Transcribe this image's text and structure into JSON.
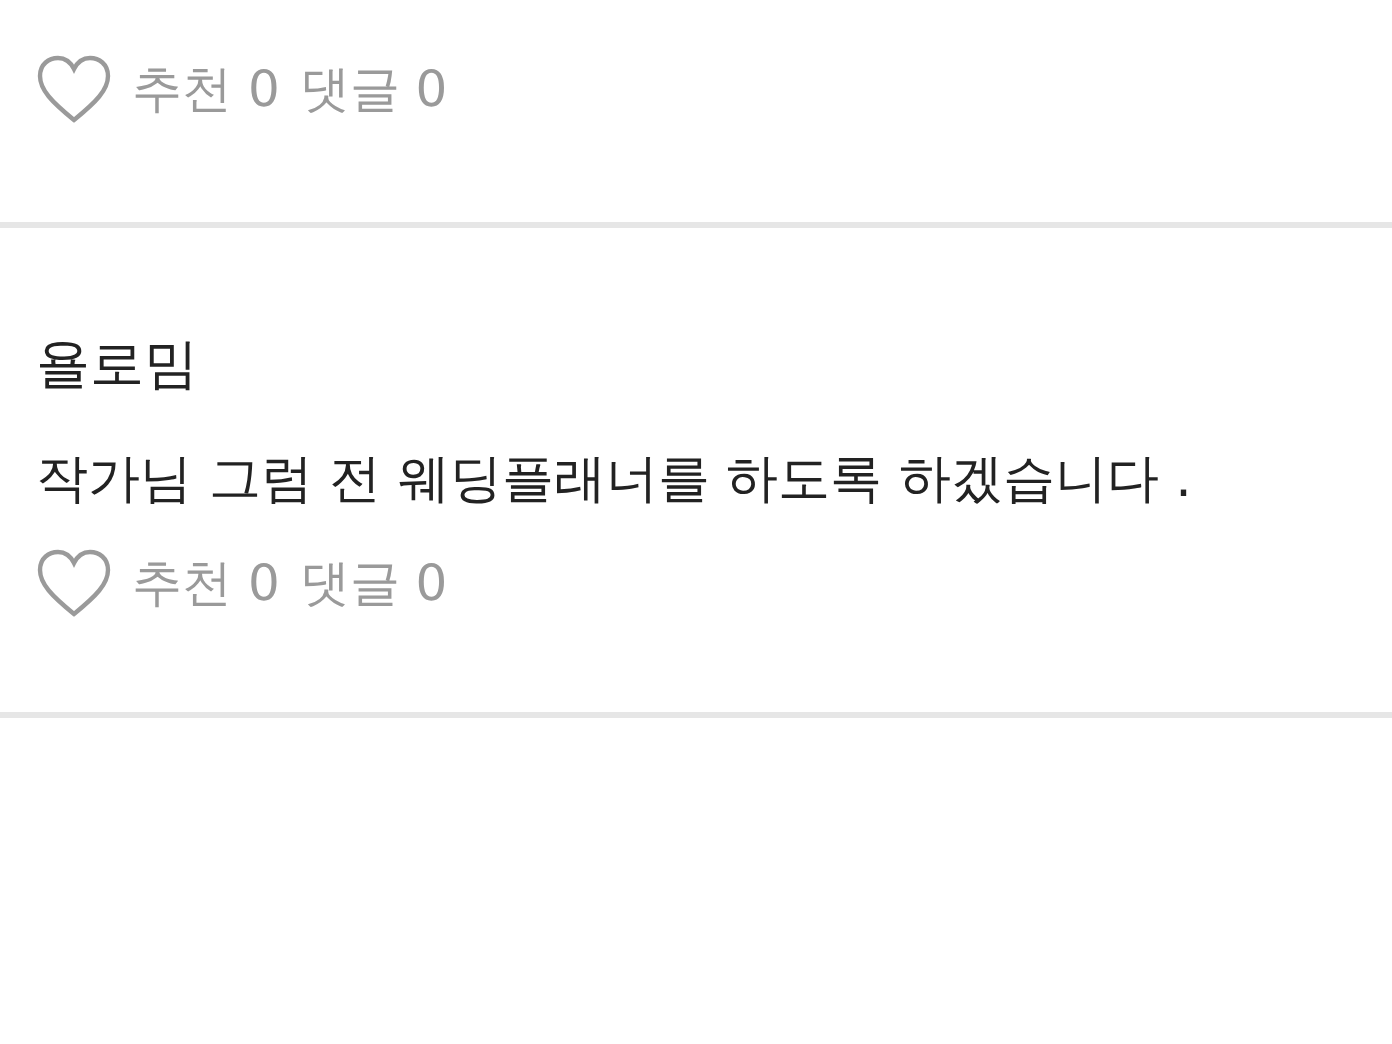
{
  "comments": [
    {
      "recommend": "추천 0",
      "replies": "댓글 0"
    },
    {
      "author": "욜로밈",
      "text": "작가님 그럼 전 웨딩플래너를 하도록 하겠습니다 .",
      "recommend": "추천 0",
      "replies": "댓글 0"
    }
  ]
}
